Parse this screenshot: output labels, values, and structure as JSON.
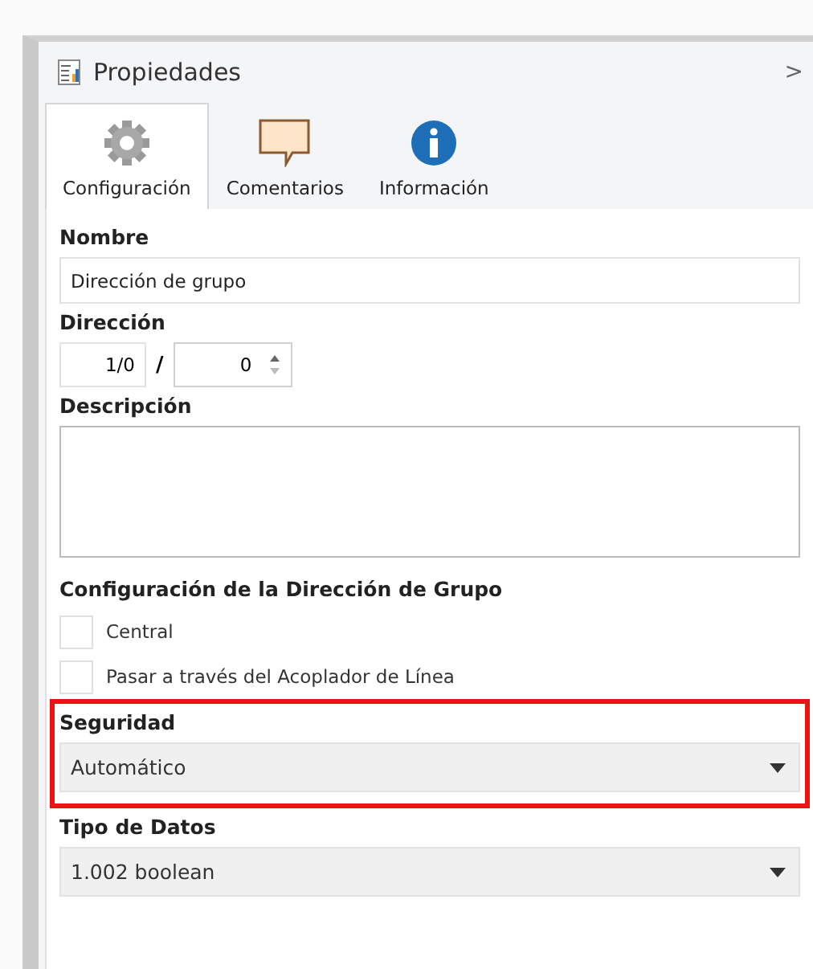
{
  "panel": {
    "title": "Propiedades",
    "collapse_glyph": ">"
  },
  "tabs": [
    {
      "label": "Configuración",
      "kind": "gear",
      "selected": true
    },
    {
      "label": "Comentarios",
      "kind": "comment",
      "selected": false
    },
    {
      "label": "Información",
      "kind": "info",
      "selected": false
    }
  ],
  "name_field": {
    "label": "Nombre",
    "value": "Dirección de grupo"
  },
  "address": {
    "label": "Dirección",
    "prefix": "1/0",
    "separator": "/",
    "value": "0"
  },
  "description": {
    "label": "Descripción"
  },
  "group_config": {
    "label": "Configuración de la Dirección de Grupo",
    "options": [
      {
        "label": "Central",
        "checked": false
      },
      {
        "label": "Pasar a través del Acoplador de Línea",
        "checked": false
      }
    ]
  },
  "dropdowns": [
    {
      "label": "Seguridad",
      "value": "Automático",
      "highlighted": true
    },
    {
      "label": "Tipo de Datos",
      "value": "1.002 boolean",
      "highlighted": false
    }
  ]
}
